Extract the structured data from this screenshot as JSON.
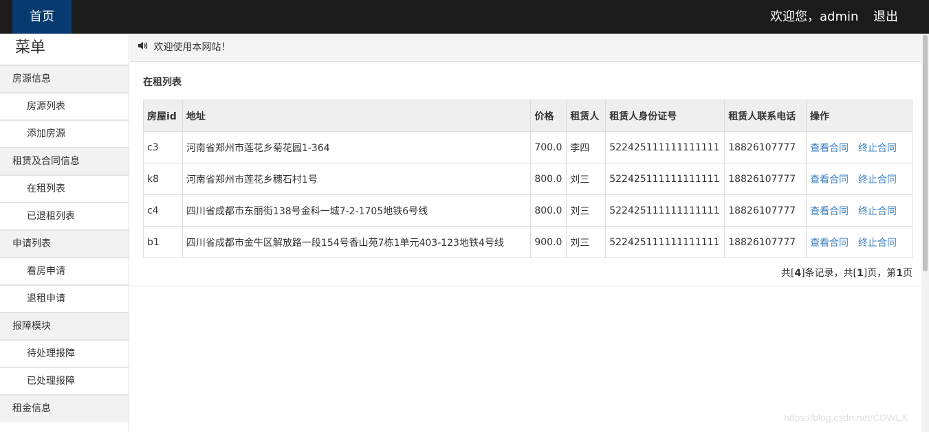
{
  "topbar": {
    "home": "首页",
    "welcome": "欢迎您，admin",
    "logout": "退出"
  },
  "sidebar": {
    "title": "菜单",
    "items": [
      {
        "label": "房源信息",
        "kind": "group"
      },
      {
        "label": "房源列表",
        "kind": "sub"
      },
      {
        "label": "添加房源",
        "kind": "sub"
      },
      {
        "label": "租赁及合同信息",
        "kind": "group"
      },
      {
        "label": "在租列表",
        "kind": "sub"
      },
      {
        "label": "已退租列表",
        "kind": "sub"
      },
      {
        "label": "申请列表",
        "kind": "group"
      },
      {
        "label": "看房申请",
        "kind": "sub"
      },
      {
        "label": "退租申请",
        "kind": "sub"
      },
      {
        "label": "报障模块",
        "kind": "group"
      },
      {
        "label": "待处理报障",
        "kind": "sub"
      },
      {
        "label": "已处理报障",
        "kind": "sub"
      },
      {
        "label": "租金信息",
        "kind": "group"
      }
    ]
  },
  "notice": {
    "text": "欢迎使用本网站！",
    "icon": "speaker-icon"
  },
  "list": {
    "title": "在租列表",
    "headers": [
      "房屋id",
      "地址",
      "价格",
      "租赁人",
      "租赁人身份证号",
      "租赁人联系电话",
      "操作"
    ],
    "rows": [
      [
        "c3",
        "河南省郑州市莲花乡菊花园1-364",
        "700.0",
        "李四",
        "522425111111111111",
        "18826107777"
      ],
      [
        "k8",
        "河南省郑州市莲花乡穗石村1号",
        "800.0",
        "刘三",
        "522425111111111111",
        "18826107777"
      ],
      [
        "c4",
        "四川省成都市东丽街138号金科一城7-2-1705地铁6号线",
        "800.0",
        "刘三",
        "522425111111111111",
        "18826107777"
      ],
      [
        "b1",
        "四川省成都市金牛区解放路一段154号香山苑7栋1单元403-123地铁4号线",
        "900.0",
        "刘三",
        "522425111111111111",
        "18826107777"
      ]
    ],
    "actions": {
      "view": "查看合同",
      "terminate": "终止合同"
    }
  },
  "pager": {
    "p1": "共[",
    "total": "4",
    "p2": "]条记录，共[",
    "pages": "1",
    "p3": "]页，第",
    "current": "1",
    "p4": "页"
  },
  "watermark": "https://blog.csdn.net/CDWLX",
  "colors": {
    "topbar": "#1b1b1b",
    "home_tab": "#073a6e",
    "link": "#3a7fc1"
  }
}
